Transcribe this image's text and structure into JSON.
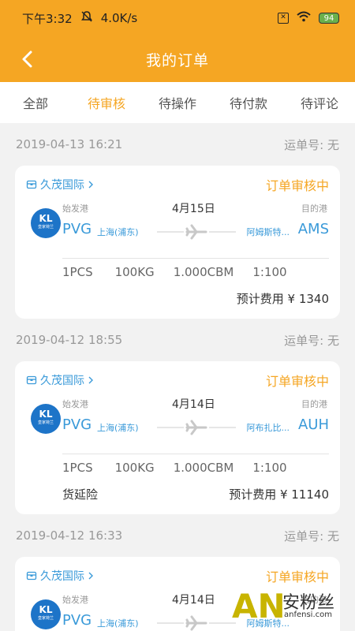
{
  "status_bar": {
    "time": "下午3:32",
    "speed": "4.0K/s",
    "battery": "94"
  },
  "nav": {
    "title": "我的订单"
  },
  "tabs": [
    {
      "label": "全部"
    },
    {
      "label": "待审核"
    },
    {
      "label": "待操作"
    },
    {
      "label": "待付款"
    },
    {
      "label": "待评论"
    }
  ],
  "orders": [
    {
      "datetime": "2019-04-13 16:21",
      "waybill": "运单号: 无",
      "company": "久茂国际",
      "status": "订单审核中",
      "from_label": "始发港",
      "to_label": "目的港",
      "date": "4月15日",
      "from_code": "PVG",
      "from_city": "上海(浦东)",
      "to_city": "阿姆斯特...",
      "to_code": "AMS",
      "pcs": "1PCS",
      "kg": "100KG",
      "cbm": "1.000CBM",
      "ratio": "1:100",
      "extra": "",
      "cost": "预计费用 ¥ 1340"
    },
    {
      "datetime": "2019-04-12 18:55",
      "waybill": "运单号: 无",
      "company": "久茂国际",
      "status": "订单审核中",
      "from_label": "始发港",
      "to_label": "目的港",
      "date": "4月14日",
      "from_code": "PVG",
      "from_city": "上海(浦东)",
      "to_city": "阿布扎比...",
      "to_code": "AUH",
      "pcs": "1PCS",
      "kg": "100KG",
      "cbm": "1.000CBM",
      "ratio": "1:100",
      "extra": "货延险",
      "cost": "预计费用 ¥ 11140"
    },
    {
      "datetime": "2019-04-12 16:33",
      "waybill": "运单号: 无",
      "company": "久茂国际",
      "status": "订单审核中",
      "from_label": "始发港",
      "to_label": "目的港",
      "date": "4月14日",
      "from_code": "PVG",
      "from_city": "上海(浦东)",
      "to_city": "阿姆斯特...",
      "to_code": "",
      "pcs": "",
      "kg": "",
      "cbm": "",
      "ratio": "",
      "extra": "",
      "cost": ""
    }
  ],
  "logo": {
    "kl": "KL",
    "sub": "皇家荷兰"
  },
  "watermark": {
    "brand": "AN",
    "text": "安粉丝",
    "url": "anfensi.com"
  },
  "icons": [
    "back-icon",
    "box-icon",
    "chevron-right-icon",
    "plane-icon",
    "wifi-icon",
    "battery-icon",
    "sim-icon",
    "mute-icon"
  ],
  "colors": {
    "accent": "#f5a623",
    "link": "#3a9ad9",
    "airline": "#1d74c8"
  }
}
